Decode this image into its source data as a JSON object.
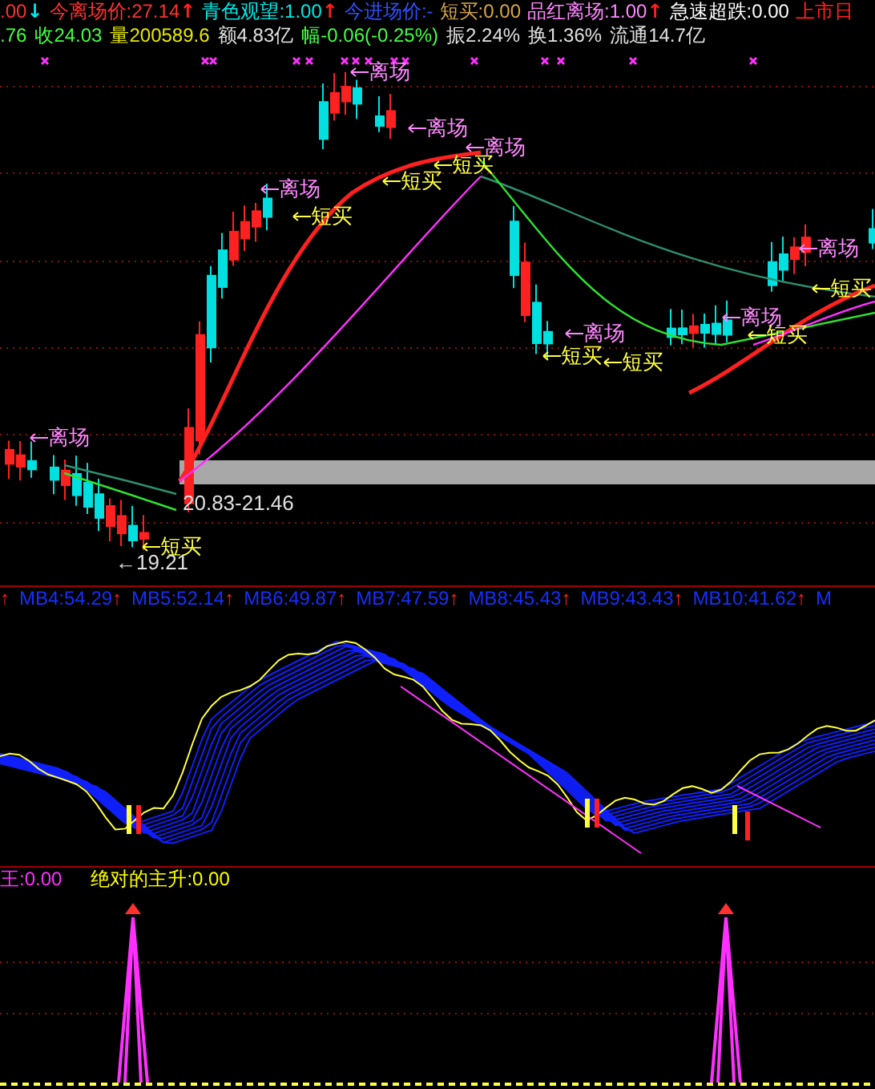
{
  "header_row_1": [
    {
      "text": ".00",
      "arrow": {
        "text": "↓",
        "color": "#00e8e8"
      },
      "color": "#ff3030"
    },
    {
      "text": "今离场价:27.14",
      "arrow": {
        "text": "↑",
        "color": "#ff2020"
      },
      "color": "#ff3030"
    },
    {
      "text": "青色观望:1.00",
      "arrow": {
        "text": "↑",
        "color": "#ff2020"
      },
      "color": "#00e8e8"
    },
    {
      "text": "今进场价:-",
      "color": "#3050ff"
    },
    {
      "text": "短买:0.00",
      "color": "#d8a848"
    },
    {
      "text": "品红离场:1.00",
      "arrow": {
        "text": "↑",
        "color": "#ff2020"
      },
      "color": "#ff88ff"
    },
    {
      "text": "急速超跌:0.00",
      "color": "#ffffff"
    },
    {
      "text": "上市日",
      "color": "#ff2020"
    }
  ],
  "header_row_2": [
    {
      "text": ".76",
      "color": "#40ff40"
    },
    {
      "text": "收24.03",
      "color": "#40ff40"
    },
    {
      "text": "量200589.6",
      "color": "#e8e800"
    },
    {
      "text": "额4.83亿",
      "color": "#e0e0e0"
    },
    {
      "text": "幅-0.06(-0.25%)",
      "color": "#40ff40"
    },
    {
      "text": "振2.24%",
      "color": "#e0e0e0"
    },
    {
      "text": "换1.36%",
      "color": "#e0e0e0"
    },
    {
      "text": "流通14.7亿",
      "color": "#e0e0e0"
    }
  ],
  "annotations": [
    {
      "kind": "exit",
      "text": "离场"
    },
    {
      "kind": "buy",
      "text": "短买"
    },
    {
      "kind": "exit",
      "text": "离场"
    },
    {
      "kind": "buy",
      "text": "短买"
    },
    {
      "kind": "exit",
      "text": "离场"
    },
    {
      "kind": "exit",
      "text": "离场"
    },
    {
      "kind": "buy",
      "text": "短买"
    },
    {
      "kind": "buy",
      "text": "短买"
    },
    {
      "kind": "exit",
      "text": "离场"
    },
    {
      "kind": "exit",
      "text": "离场"
    },
    {
      "kind": "buy",
      "text": "短买"
    },
    {
      "kind": "buy",
      "text": "短买"
    },
    {
      "kind": "exit",
      "text": "离场"
    },
    {
      "kind": "buy",
      "text": "短买"
    },
    {
      "kind": "exit",
      "text": "离场"
    },
    {
      "kind": "buy",
      "text": "短买"
    }
  ],
  "range_label": "20.83-21.46",
  "low_label": "←19.21",
  "indicator_row": {
    "lead_arrow": "↑",
    "items": [
      {
        "label": "MB4:54.29",
        "arrow": "↑"
      },
      {
        "label": "MB5:52.14",
        "arrow": "↑"
      },
      {
        "label": "MB6:49.87",
        "arrow": "↑"
      },
      {
        "label": "MB7:47.59",
        "arrow": "↑"
      },
      {
        "label": "MB8:45.43",
        "arrow": "↑"
      },
      {
        "label": "MB9:43.43",
        "arrow": "↑"
      },
      {
        "label": "MB10:41.62",
        "arrow": "↑"
      },
      {
        "label": "M"
      }
    ]
  },
  "bottom_legend": [
    {
      "text": "王:0.00",
      "color": "#ff30ff"
    },
    {
      "text": "绝对的主升:0.00",
      "color": "#ffff00"
    }
  ]
}
